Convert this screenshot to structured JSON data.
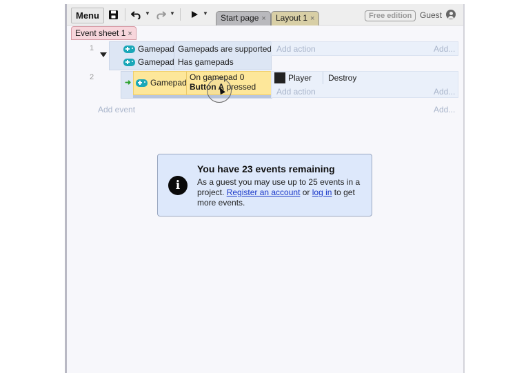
{
  "toolbar": {
    "menu_label": "Menu",
    "tabs": [
      {
        "label": "Start page",
        "close": "×"
      },
      {
        "label": "Layout 1",
        "close": "×"
      }
    ],
    "free_badge": "Free edition",
    "guest_label": "Guest"
  },
  "sheet_tab": {
    "label": "Event sheet 1",
    "close": "×"
  },
  "events": [
    {
      "number": "1",
      "conditions": [
        {
          "object": "Gamepad",
          "text": "Gamepads are supported"
        },
        {
          "object": "Gamepad",
          "text": "Has gamepads"
        }
      ],
      "add_action": "Add action",
      "add": "Add..."
    },
    {
      "number": "2",
      "condition": {
        "object": "Gamepad",
        "line1": "On gamepad 0",
        "line2_bold": "Button A",
        "line2_rest": " pressed"
      },
      "action": {
        "object": "Player",
        "text": "Destroy"
      },
      "add_action": "Add action",
      "add": "Add..."
    }
  ],
  "add_event": "Add event",
  "add_event_right": "Add...",
  "notice": {
    "title": "You have 23 events remaining",
    "body_1": "As a guest you may use up to 25 events in a project. ",
    "register_link": "Register an account",
    "body_2": " or ",
    "login_link": "log in",
    "body_3": " to get more events."
  },
  "colors": {
    "trigger_condition": "#fde79a",
    "event_block": "#dde6f4",
    "notice_bg": "#dde8fb",
    "gamepad_icon": "#1aa7b8",
    "link": "#1a38c9"
  },
  "icons": [
    "save-icon",
    "undo-icon",
    "redo-icon",
    "play-icon",
    "gamepad-icon",
    "info-icon",
    "user-icon"
  ]
}
